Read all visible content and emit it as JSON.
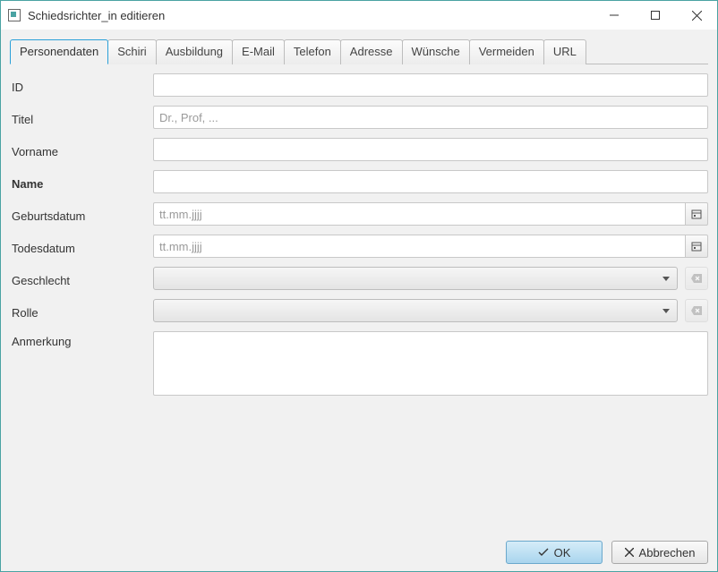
{
  "window": {
    "title": "Schiedsrichter_in editieren"
  },
  "tabs": [
    {
      "label": "Personendaten",
      "active": true
    },
    {
      "label": "Schiri"
    },
    {
      "label": "Ausbildung"
    },
    {
      "label": "E-Mail"
    },
    {
      "label": "Telefon"
    },
    {
      "label": "Adresse"
    },
    {
      "label": "Wünsche"
    },
    {
      "label": "Vermeiden"
    },
    {
      "label": "URL"
    }
  ],
  "form": {
    "id": {
      "label": "ID",
      "value": "",
      "placeholder": ""
    },
    "titel": {
      "label": "Titel",
      "value": "",
      "placeholder": "Dr., Prof, ..."
    },
    "vorname": {
      "label": "Vorname",
      "value": "",
      "placeholder": ""
    },
    "name": {
      "label": "Name",
      "value": "",
      "placeholder": ""
    },
    "geburtsdatum": {
      "label": "Geburtsdatum",
      "value": "",
      "placeholder": "tt.mm.jjjj"
    },
    "todesdatum": {
      "label": "Todesdatum",
      "value": "",
      "placeholder": "tt.mm.jjjj"
    },
    "geschlecht": {
      "label": "Geschlecht",
      "value": ""
    },
    "rolle": {
      "label": "Rolle",
      "value": ""
    },
    "anmerkung": {
      "label": "Anmerkung",
      "value": ""
    }
  },
  "buttons": {
    "ok": "OK",
    "cancel": "Abbrechen"
  }
}
